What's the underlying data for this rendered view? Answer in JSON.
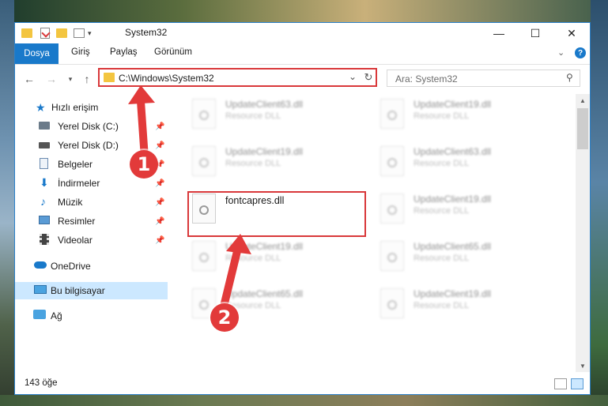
{
  "window": {
    "title": "System32",
    "controls": {
      "minimize": "—",
      "maximize": "☐",
      "close": "✕"
    }
  },
  "ribbon": {
    "tabs": [
      {
        "label": "Dosya",
        "active": true
      },
      {
        "label": "Giriş"
      },
      {
        "label": "Paylaş"
      },
      {
        "label": "Görünüm"
      }
    ],
    "expand_icon": "chevron-down-icon",
    "help_icon": "help-icon"
  },
  "navigation": {
    "back_icon": "back-arrow-icon",
    "forward_icon": "forward-arrow-icon",
    "recent_icon": "chevron-down-icon",
    "up_icon": "up-arrow-icon",
    "address": "C:\\Windows\\System32",
    "search_placeholder": "Ara: System32"
  },
  "sidebar": {
    "items": [
      {
        "label": "Hızlı erişim",
        "icon": "star-icon",
        "pinned": false
      },
      {
        "label": "Yerel Disk (C:)",
        "icon": "drive-icon",
        "pinned": true
      },
      {
        "label": "Yerel Disk (D:)",
        "icon": "drive-icon",
        "pinned": true
      },
      {
        "label": "Belgeler",
        "icon": "documents-icon",
        "pinned": true
      },
      {
        "label": "İndirmeler",
        "icon": "download-icon",
        "pinned": true
      },
      {
        "label": "Müzik",
        "icon": "music-icon",
        "pinned": true
      },
      {
        "label": "Resimler",
        "icon": "pictures-icon",
        "pinned": true
      },
      {
        "label": "Videolar",
        "icon": "videos-icon",
        "pinned": true
      },
      {
        "label": "OneDrive",
        "icon": "cloud-icon",
        "pinned": false
      },
      {
        "label": "Bu bilgisayar",
        "icon": "computer-icon",
        "pinned": false,
        "selected": true
      },
      {
        "label": "Ağ",
        "icon": "network-icon",
        "pinned": false
      }
    ]
  },
  "files": {
    "left_column": [
      {
        "name": "UpdateClient63.dll",
        "type": "Resource DLL",
        "blurred": true
      },
      {
        "name": "UpdateClient19.dll",
        "type": "Resource DLL",
        "blurred": true
      },
      {
        "name": "fontcapres.dll",
        "type": "",
        "blurred": false,
        "highlighted": true
      },
      {
        "name": "UpdateClient19.dll",
        "type": "Resource DLL",
        "blurred": true
      },
      {
        "name": "UpdateClient65.dll",
        "type": "Resource DLL",
        "blurred": true
      }
    ],
    "right_column": [
      {
        "name": "UpdateClient19.dll",
        "type": "Resource DLL",
        "blurred": true
      },
      {
        "name": "UpdateClient63.dll",
        "type": "Resource DLL",
        "blurred": true
      },
      {
        "name": "UpdateClient19.dll",
        "type": "Resource DLL",
        "blurred": true
      },
      {
        "name": "UpdateClient65.dll",
        "type": "Resource DLL",
        "blurred": true
      },
      {
        "name": "UpdateClient19.dll",
        "type": "Resource DLL",
        "blurred": true
      }
    ]
  },
  "status": {
    "item_count": "143 öğe"
  },
  "callouts": [
    {
      "number": "1"
    },
    {
      "number": "2"
    }
  ],
  "colors": {
    "accent": "#1979ca",
    "highlight": "#d9383a",
    "selection": "#cce8ff"
  }
}
